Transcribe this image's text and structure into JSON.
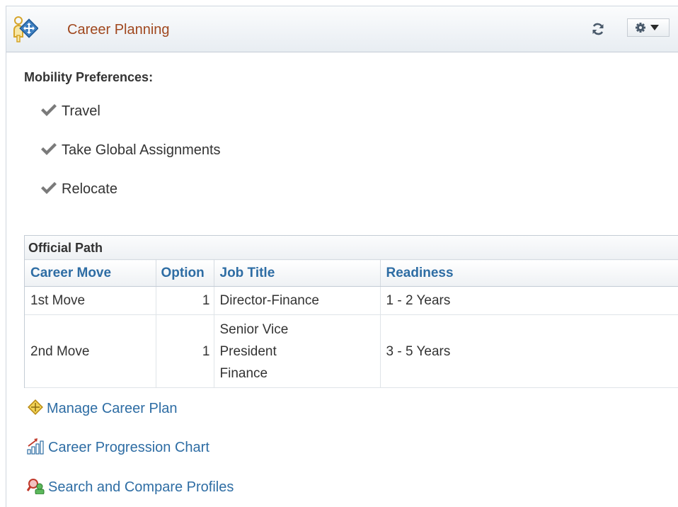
{
  "pagelet": {
    "title": "Career Planning",
    "icons": {
      "header": "career-planning-icon",
      "refresh": "refresh-icon",
      "settings": "gear-icon"
    }
  },
  "mobility": {
    "label": "Mobility Preferences:",
    "items": [
      {
        "label": "Travel",
        "icon": "checkmark-icon"
      },
      {
        "label": "Take Global Assignments",
        "icon": "checkmark-icon"
      },
      {
        "label": "Relocate",
        "icon": "checkmark-icon"
      }
    ]
  },
  "official_path": {
    "title": "Official Path",
    "columns": [
      "Career Move",
      "Option",
      "Job Title",
      "Readiness"
    ],
    "rows": [
      {
        "career_move": "1st Move",
        "option": "1",
        "job_title": [
          "Director-Finance"
        ],
        "readiness": "1 - 2 Years"
      },
      {
        "career_move": "2nd Move",
        "option": "1",
        "job_title": [
          "Senior Vice",
          "President",
          "Finance"
        ],
        "readiness": "3 - 5 Years"
      }
    ]
  },
  "links": [
    {
      "label": "Manage Career Plan",
      "icon": "career-plan-icon"
    },
    {
      "label": "Career Progression Chart",
      "icon": "progression-chart-icon"
    },
    {
      "label": "Search and Compare Profiles",
      "icon": "compare-profiles-icon"
    }
  ],
  "colors": {
    "title": "#a0481f",
    "link": "#2e6da4",
    "text": "#333333"
  }
}
